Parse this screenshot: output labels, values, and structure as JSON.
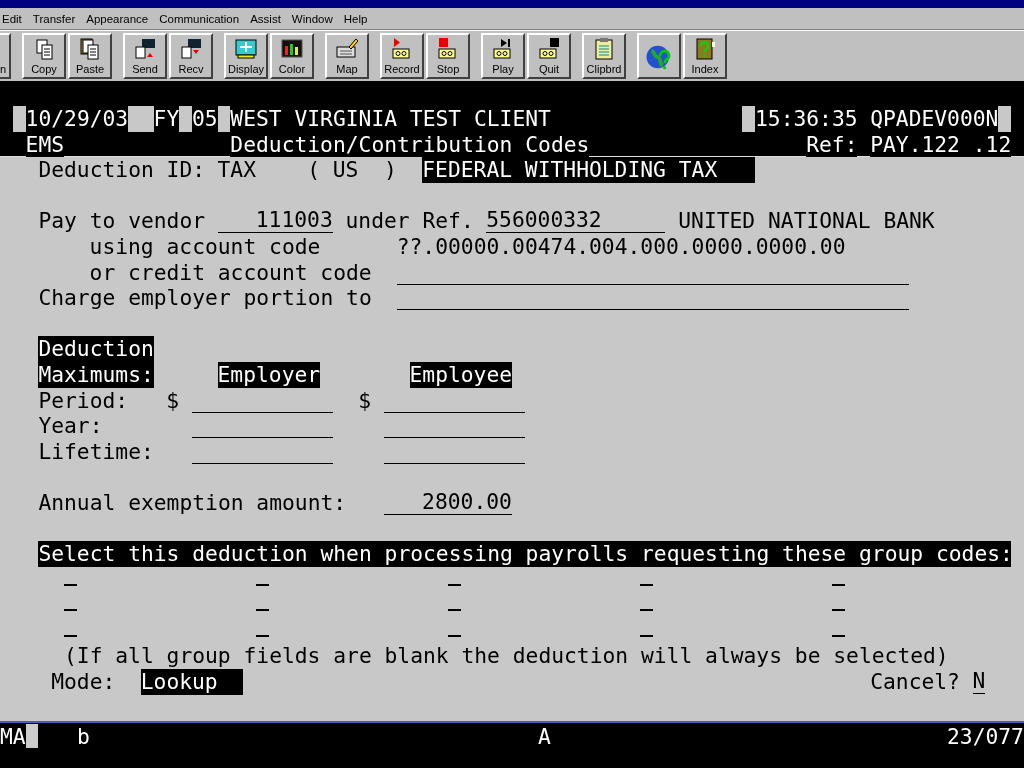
{
  "menu": [
    "Edit",
    "Transfer",
    "Appearance",
    "Communication",
    "Assist",
    "Window",
    "Help"
  ],
  "toolbar": [
    [
      {
        "kind": "partial",
        "label": "n"
      }
    ],
    [
      {
        "kind": "copy",
        "label": "Copy"
      },
      {
        "kind": "paste",
        "label": "Paste"
      }
    ],
    [
      {
        "kind": "send",
        "label": "Send"
      },
      {
        "kind": "recv",
        "label": "Recv"
      }
    ],
    [
      {
        "kind": "display",
        "label": "Display"
      },
      {
        "kind": "color",
        "label": "Color"
      }
    ],
    [
      {
        "kind": "map",
        "label": "Map"
      }
    ],
    [
      {
        "kind": "record",
        "label": "Record"
      },
      {
        "kind": "stop",
        "label": "Stop"
      }
    ],
    [
      {
        "kind": "play",
        "label": "Play"
      },
      {
        "kind": "quit",
        "label": "Quit"
      }
    ],
    [
      {
        "kind": "clipboard",
        "label": "Clipbrd"
      }
    ],
    [
      {
        "kind": "globe"
      },
      {
        "kind": "index",
        "label": "Index"
      }
    ]
  ],
  "header": {
    "date": "10/29/03",
    "fy_label": "FY",
    "fy": "05",
    "client": "WEST VIRGINIA TEST CLIENT",
    "time": "15:36:35",
    "device": "QPADEV000N",
    "system": "EMS",
    "screen_title": "Deduction/Contribution Codes",
    "ref_label": "Ref:",
    "ref": "PAY.122 .12"
  },
  "deduction": {
    "id_label": "Deduction ID:",
    "id": "TAX",
    "country": "( US  )",
    "description": "FEDERAL WITHHOLDING TAX"
  },
  "vendor": {
    "label": "Pay to vendor",
    "vendor": "111003",
    "ref_label": "under Ref.",
    "ref": "556000332",
    "name": "UNITED NATIONAL BANK"
  },
  "account": {
    "label": "using account code",
    "value": "??.00000.00474.004.000.0000.0000.00"
  },
  "credit_account": {
    "label": "or credit account code"
  },
  "employer_portion": {
    "label": "Charge employer portion to"
  },
  "maximums": {
    "title": [
      "Deduction",
      "Maximums:"
    ],
    "employer_heading": "Employer",
    "employee_heading": "Employee",
    "rows": [
      {
        "label": "Period:",
        "employer_currency": "$",
        "employee_currency": "$"
      },
      {
        "label": "Year:"
      },
      {
        "label": "Lifetime:"
      }
    ]
  },
  "exemption": {
    "label": "Annual exemption amount:",
    "value": "2800.00"
  },
  "group_codes": {
    "prompt": "Select this deduction when processing payrolls requesting these group codes:",
    "rows": [
      [
        {
          "kind": "input"
        },
        {
          "kind": "input"
        },
        {
          "kind": "input"
        },
        {
          "kind": "input"
        },
        {
          "kind": "input"
        }
      ],
      [
        {
          "kind": "input"
        },
        {
          "kind": "input"
        },
        {
          "kind": "input"
        },
        {
          "kind": "input"
        },
        {
          "kind": "input"
        }
      ],
      [
        {
          "kind": "input"
        },
        {
          "kind": "input"
        },
        {
          "kind": "input"
        },
        {
          "kind": "input"
        },
        {
          "kind": "input"
        }
      ]
    ],
    "note": "(If all group fields are blank the deduction will always be selected)"
  },
  "mode": {
    "label": "Mode:",
    "value": "Lookup"
  },
  "cancel": {
    "label": "Cancel?",
    "value": "N"
  },
  "status_bar": {
    "mode": "MA",
    "indicator": "b",
    "shift": "A",
    "position": "23/077"
  }
}
